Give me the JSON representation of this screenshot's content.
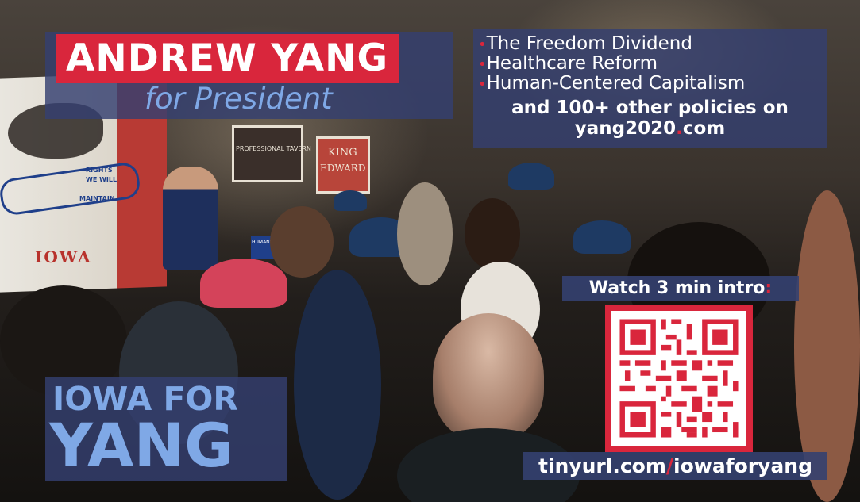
{
  "header": {
    "title": "ANDREW YANG",
    "subtitle": "for President"
  },
  "policies": {
    "items": [
      "The Freedom Dividend",
      "Healthcare Reform",
      "Human-Centered Capitalism"
    ],
    "more_line1": "and 100+ other policies on",
    "more_site": "yang2020",
    "more_dot": ".",
    "more_tld": "com"
  },
  "video": {
    "label": "Watch 3 min intro",
    "colon": ":",
    "url_host": "tinyurl.com",
    "url_slash": "/",
    "url_path": "iowaforyang"
  },
  "footer": {
    "line1": "IOWA FOR",
    "line2": "YANG"
  },
  "photo": {
    "flag_text": "IOWA",
    "ribbon_words": [
      "RIGHTS",
      "WE WILL",
      "MAINTAIN"
    ],
    "sign_left": "PROFESSIONAL TAVERN",
    "sign_right_1": "KING",
    "sign_right_2": "EDWARD",
    "held_sign": "HUMANITY FIRST"
  },
  "colors": {
    "red": "#d9263c",
    "navy_panel": "#344070",
    "light_blue": "#7fa8e6",
    "white": "#ffffff"
  }
}
